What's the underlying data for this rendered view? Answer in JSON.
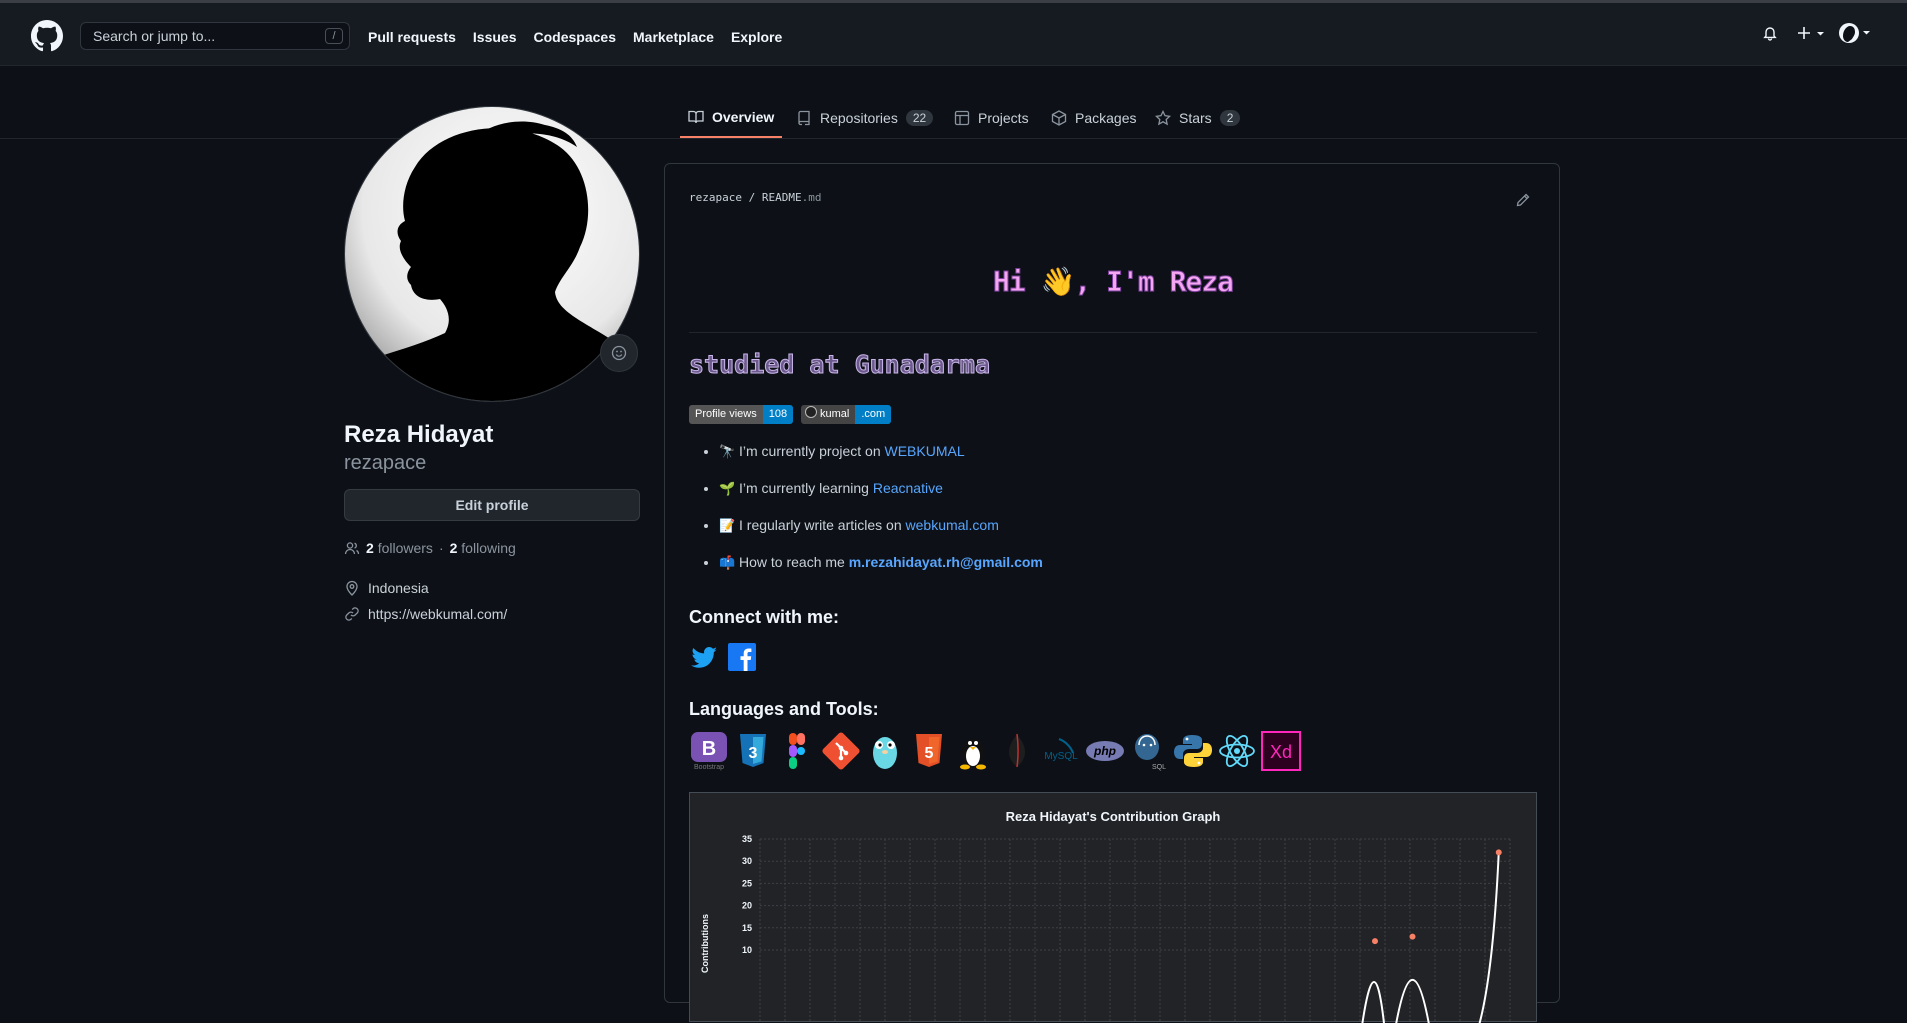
{
  "header": {
    "search_placeholder": "Search or jump to...",
    "slash_key": "/",
    "nav": [
      "Pull requests",
      "Issues",
      "Codespaces",
      "Marketplace",
      "Explore"
    ]
  },
  "tabs": [
    {
      "label": "Overview",
      "icon": "book-icon",
      "active": true
    },
    {
      "label": "Repositories",
      "icon": "repo-icon",
      "count": "22"
    },
    {
      "label": "Projects",
      "icon": "table-icon"
    },
    {
      "label": "Packages",
      "icon": "package-icon"
    },
    {
      "label": "Stars",
      "icon": "star-icon",
      "count": "2"
    }
  ],
  "profile": {
    "name": "Reza Hidayat",
    "username": "rezapace",
    "edit_label": "Edit profile",
    "followers_count": "2",
    "followers_label": "followers",
    "separator": "·",
    "following_count": "2",
    "following_label": "following",
    "location": "Indonesia",
    "website": "https://webkumal.com/"
  },
  "readme": {
    "owner": "rezapace",
    "slash": "/",
    "file_base": "README",
    "file_ext": ".md",
    "title": "Hi 👋, I'm Reza",
    "subtitle": "studied at Gunadarma",
    "badges": {
      "views_label": "Profile views",
      "views_count": "108",
      "site_left": "kumal",
      "site_right": ".com"
    },
    "items": [
      {
        "emoji": "🔭",
        "text": "I’m currently project on ",
        "link": "WEBKUMAL"
      },
      {
        "emoji": "🌱",
        "text": "I’m currently learning ",
        "link": "Reacnative"
      },
      {
        "emoji": "📝",
        "text": "I regularly write articles on ",
        "link": "webkumal.com"
      },
      {
        "emoji": "📫",
        "text": "How to reach me ",
        "link": "m.rezahidayat.rh@gmail.com"
      }
    ],
    "connect_heading": "Connect with me:",
    "tools_heading": "Languages and Tools:",
    "tools": [
      "bootstrap",
      "css3",
      "figma",
      "git",
      "go",
      "html5",
      "linux",
      "mongodb",
      "mysql",
      "php",
      "postgresql",
      "python",
      "react",
      "xd"
    ],
    "tool_labels": {
      "bootstrap": "Bootstrap",
      "mysql": "MySQL",
      "php": "php",
      "postgresql": "SQL",
      "xd": "Xd"
    }
  },
  "graph_title": "Reza Hidayat's Contribution Graph",
  "chart_data": {
    "type": "line",
    "title": "Reza Hidayat's Contribution Graph",
    "ylabel": "Contributions",
    "yticks": [
      10,
      15,
      20,
      25,
      30,
      35
    ],
    "ylim": [
      10,
      35
    ],
    "series": [
      {
        "points": [
          [
            0.82,
            12
          ],
          [
            0.87,
            13
          ],
          [
            0.985,
            32
          ]
        ]
      }
    ],
    "grid": true,
    "line_color": "#ffffff",
    "point_color": "#f78166"
  },
  "colors": {
    "bg": "#0d1117",
    "header_bg": "#161b22",
    "accent": "#f78166",
    "link": "#58a6ff"
  }
}
